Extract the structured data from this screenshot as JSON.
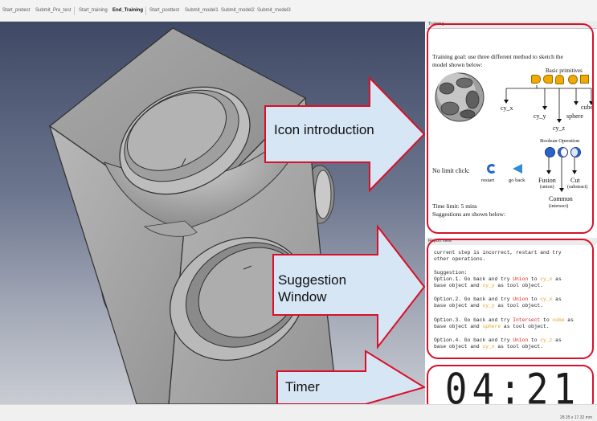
{
  "toolbar": {
    "buttons": [
      "Start_pretest",
      "Submit_Pre_test",
      "Start_training",
      "End_Training",
      "Start_posttest",
      "Submit_model1",
      "Submit_model2",
      "Submit_model3"
    ]
  },
  "panels": {
    "training_title": "Training",
    "report_title": "Report view"
  },
  "training": {
    "goal_line1": "Training goal: use three different method to sketch the",
    "goal_line2": "model shown below:",
    "basic_primitives": "Basic primitives",
    "prim_labels": {
      "cy_x": "cy_x",
      "cy_y": "cy_y",
      "sphere": "sphere",
      "cube": "cube",
      "cy_z": "cy_z"
    },
    "boolean_operation": "Boolean Operation",
    "no_limit_click": "No limit click:",
    "restart": "restart",
    "go_back": "go back",
    "fusion": "Fusion",
    "fusion_sub": "(union)",
    "cut": "Cut",
    "cut_sub": "(substract)",
    "common": "Common",
    "common_sub": "(intersect)",
    "time_limit": "Time limit: 5 mins",
    "suggestions_below": "Suggestions are shown below:"
  },
  "report": {
    "l1": "current step is incorrect, restart and try",
    "l2": "other operations.",
    "suggestion": "Suggestion:",
    "o1_a": "Option.1. Go back and try ",
    "o1_op": "Union",
    "o1_b": " to ",
    "o1_obj": "cy_x",
    "o1_c": " as",
    "o1_d": "base object and ",
    "o1_tool": "cy_y",
    "o1_e": " as tool object.",
    "o2_a": "Option.2. Go back and try ",
    "o2_op": "Union",
    "o2_b": " to ",
    "o2_obj": "cy_x",
    "o2_c": " as",
    "o2_d": "base object and ",
    "o2_tool": "cy_y",
    "o2_e": " as tool object.",
    "o3_a": "Option.3. Go back and try ",
    "o3_op": "Intersect",
    "o3_b": " to ",
    "o3_obj": "cube",
    "o3_c": " as",
    "o3_d": "base object and ",
    "o3_tool": "sphere",
    "o3_e": " as tool object.",
    "o4_a": "Option.4. Go back and try ",
    "o4_op": "Union",
    "o4_b": " to ",
    "o4_obj": "cy_z",
    "o4_c": " as",
    "o4_d": "base object and ",
    "o4_tool": "cy_x",
    "o4_e": " as tool object."
  },
  "timer": {
    "minutes": "04",
    "seconds": "21"
  },
  "callouts": {
    "icon_intro": "Icon introduction",
    "suggestion_line1": "Suggestion",
    "suggestion_line2": "Window",
    "timer": "Timer"
  },
  "statusbar": {
    "dims": "28.35 x 17.32 mm"
  },
  "colors": {
    "accent_red": "#d9102a",
    "callout_fill": "#d6e6f5",
    "timer_lcd": "#1d1d1d",
    "operation_red": "#d8261a",
    "object_orange": "#e7a117"
  }
}
